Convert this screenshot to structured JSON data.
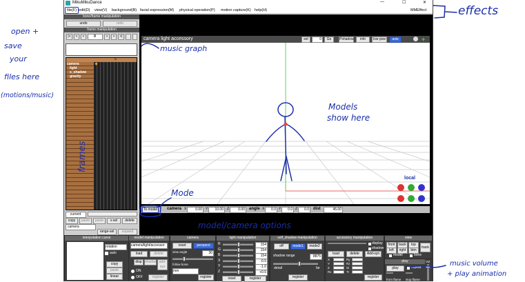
{
  "window": {
    "title": "MikuMikuDance",
    "menu": [
      {
        "label": "file(F)",
        "highlight": true
      },
      {
        "label": "edit(D)"
      },
      {
        "label": "view(V)"
      },
      {
        "label": "background(B)"
      },
      {
        "label": "facial expression(M)"
      },
      {
        "label": "physical operation(P)"
      },
      {
        "label": "motion capture(K)"
      },
      {
        "label": "help(H)"
      }
    ],
    "mme": "MMEffect",
    "controls": {
      "min": "—",
      "max": "☐",
      "close": "✕"
    }
  },
  "bone_panel": {
    "title": "bone/frame manipulation",
    "undo": "undo",
    "redo": "redo",
    "frame_title": "frame manipulation",
    "frame_value": "0",
    "nav": [
      "|<",
      "<",
      "<",
      ">",
      ">",
      ">|"
    ],
    "col_header": "5",
    "tracks": [
      "camera",
      "light",
      "s_shadow",
      "gravity"
    ],
    "current": "current",
    "row1": [
      "copy",
      "paste",
      "paste",
      "v-sel",
      "delete"
    ],
    "select_value": "camera",
    "range_sel": "range-sel",
    "expand": "expand"
  },
  "viewport": {
    "title": "camera light accessory",
    "top_buttons": [
      "set",
      "0",
      "Go",
      "Pshadow",
      "info",
      "low pow",
      "axis"
    ],
    "local": "local",
    "to_model": "To model",
    "camera_label": "camera",
    "angle_label": "angle",
    "dist_label": "dist",
    "axes": [
      "X",
      "Y",
      "Z"
    ],
    "camera_values": [
      "0.00",
      "10.00",
      "0.00"
    ],
    "angle_values": [
      "0.0",
      "0.0",
      "0.0"
    ],
    "dist_value": "45.00"
  },
  "bottom": {
    "interp_title": "interpolation curve",
    "interp_checks": [
      "rotation",
      "auto"
    ],
    "interp_btns": [
      "copy",
      "paste",
      "linear"
    ],
    "model_title": "model manipulation",
    "model_select": "camera/light/accessor",
    "model_btns": [
      "load",
      "delete"
    ],
    "model_disp": [
      "disp",
      "shadow",
      "add-sys"
    ],
    "model_onoff": [
      "ON",
      "OFF"
    ],
    "register": "register",
    "camera_title": "camera",
    "camera_reset": "reset",
    "camera_perspect": "perspect",
    "view_angle_label": "view angle",
    "view_angle": "30",
    "follow_bone": "follow bone",
    "follow_value": "non",
    "light_title": "light manipulation",
    "light_labels": [
      "R",
      "G",
      "B",
      "X",
      "Y",
      "Z"
    ],
    "light_values": [
      "154",
      "154",
      "154",
      "-0.5",
      "-1.0",
      "+0.5"
    ],
    "light_btns": [
      "reset",
      "register"
    ],
    "shadow_title": "self_shadow manipulation",
    "shadow_modes": [
      "off",
      "mode1",
      "mode2"
    ],
    "shadow_range": "shadow range",
    "shadow_value": "8875",
    "detail": "detail",
    "far": "far",
    "acc_title": "accessory manipulation",
    "acc_checks": [
      "display",
      "shadow"
    ],
    "acc_btns": [
      "load",
      "delete",
      "Add-syn"
    ],
    "acc_axes": [
      "X",
      "Y",
      "Z",
      "Rx",
      "Ry",
      "Rz",
      "Si",
      "Tr"
    ],
    "view_title": "view",
    "view_btns": [
      "front",
      "back",
      "top",
      "left",
      "right",
      "btm"
    ],
    "track": "track",
    "view_checks": [
      "model",
      "bone"
    ],
    "play_title": "play",
    "play": "play",
    "repeat": "repeat",
    "from_frame": "from flame",
    "stop_frame": "stop flame",
    "vol": "Vol"
  },
  "annotations": {
    "effects": "effects",
    "open_save": [
      "open +",
      "save",
      "your",
      "files here",
      "(motions/music)"
    ],
    "music_graph": "music graph",
    "models": [
      "Models",
      "show here"
    ],
    "frames": "frames",
    "mode": "Mode",
    "options": "model/camera options",
    "music": [
      "music volume",
      "+ play animation"
    ]
  }
}
